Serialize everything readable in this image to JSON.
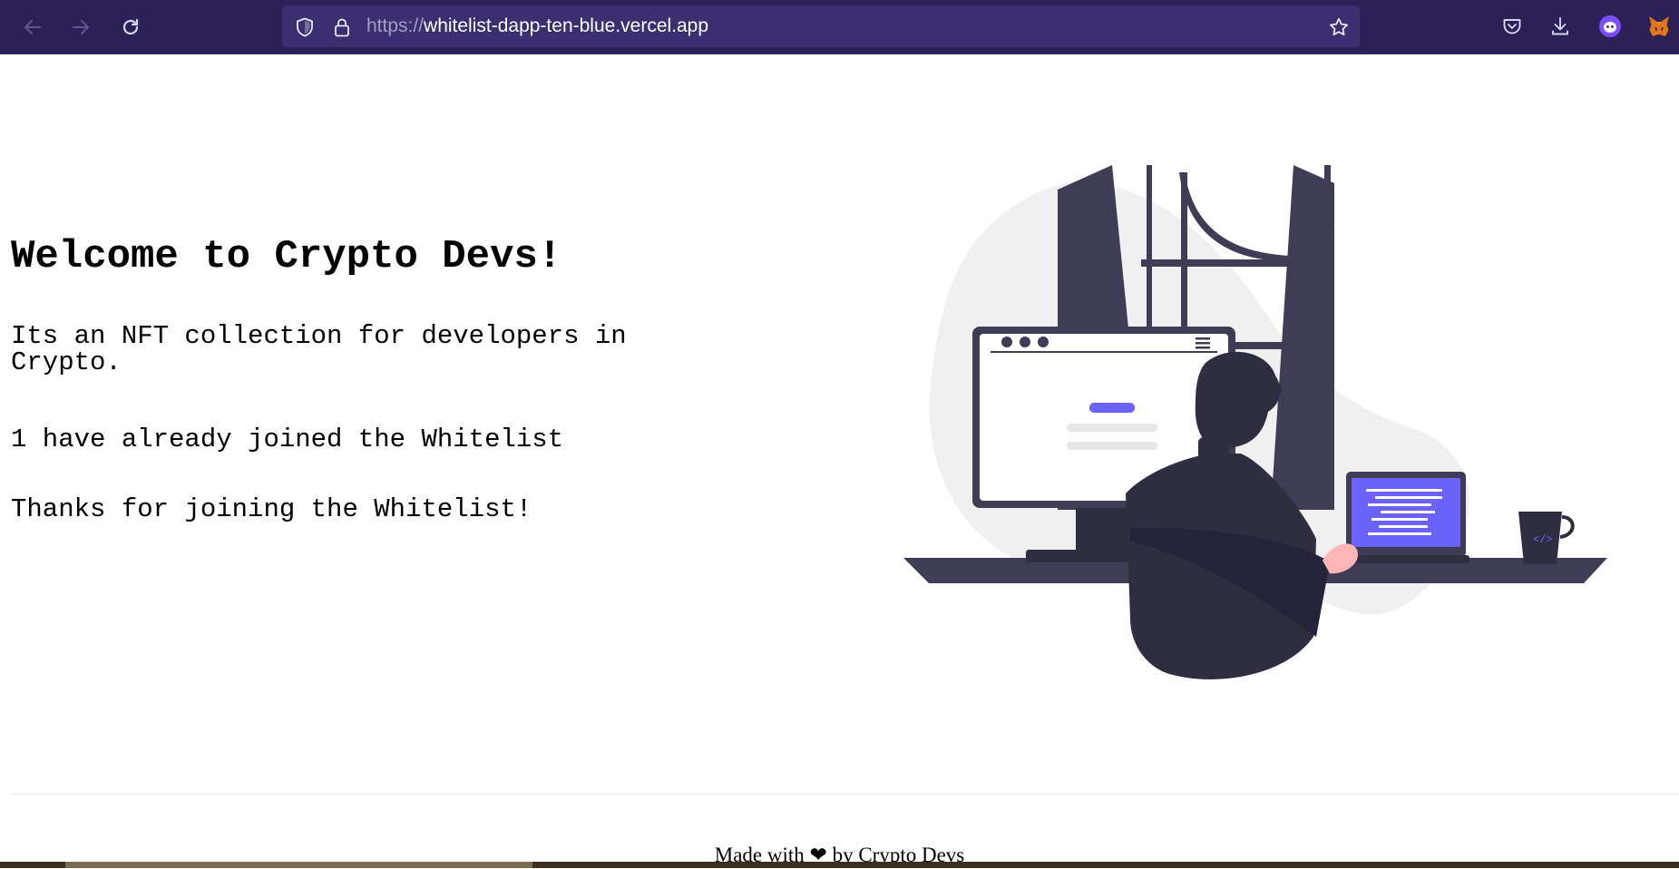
{
  "browser": {
    "url_scheme": "https://",
    "url_host": "whitelist-dapp-ten-blue.vercel.app",
    "toolbar_color": "#2b2157",
    "urlbar_color": "#3b2f72"
  },
  "page": {
    "title": "Welcome to Crypto Devs!",
    "description": "Its an NFT collection for developers in Crypto.",
    "joined_count_text": "1 have already joined the Whitelist",
    "status_text": "Thanks for joining the Whitelist!",
    "accent_color": "#6c63ff"
  },
  "footer": {
    "prefix": "Made with",
    "heart": "❤",
    "suffix": "by Crypto Devs"
  },
  "icons": {
    "back": "arrow-left-icon",
    "forward": "arrow-right-icon",
    "reload": "reload-icon",
    "tracking_protection": "shield-icon",
    "secure": "lock-icon",
    "bookmark": "star-icon",
    "pocket": "pocket-icon",
    "downloads": "download-icon",
    "extension": "extension-icon",
    "metamask": "metamask-fox-icon"
  }
}
